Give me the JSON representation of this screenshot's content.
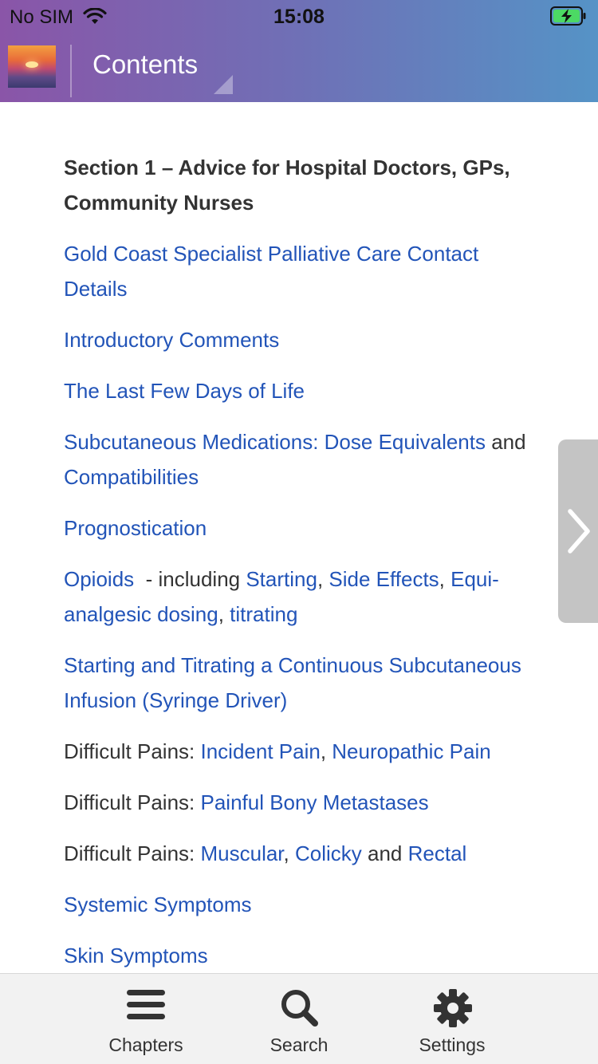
{
  "status_bar": {
    "carrier": "No SIM",
    "time": "15:08"
  },
  "header": {
    "title": "Contents"
  },
  "section_heading": "Section 1 – Advice for Hospital Doctors, GPs, Community Nurses",
  "toc": {
    "gold_coast": "Gold Coast Specialist Palliative Care Contact Details",
    "intro": "Introductory Comments",
    "last_days": "The Last Few Days of Life",
    "subcut_a": "Subcutaneous Medications: Dose Equivalents",
    "subcut_and": " and ",
    "subcut_b": "Compatibilities",
    "prognostication": "Prognostication",
    "opioids": "Opioids",
    "opioids_text": "  - including ",
    "opioids_starting": "Starting",
    "sep_comma": ", ",
    "opioids_side": "Side Effects",
    "opioids_equi": "Equi-analgesic dosing",
    "opioids_titrating": "titrating",
    "csci": "Starting and Titrating a Continuous Subcutaneous Infusion (Syringe Driver)",
    "difficult_prefix": "Difficult Pains: ",
    "incident": "Incident Pain",
    "neuropathic": "Neuropathic Pain",
    "bony": "Painful Bony Metastases",
    "muscular": "Muscular",
    "colicky": "Colicky",
    "and": " and ",
    "rectal": "Rectal",
    "systemic": "Systemic Symptoms",
    "skin": "Skin Symptoms"
  },
  "tabs": [
    {
      "label": "Chapters",
      "icon": "menu-icon"
    },
    {
      "label": "Search",
      "icon": "search-icon"
    },
    {
      "label": "Settings",
      "icon": "gear-icon"
    }
  ],
  "colors": {
    "link": "#2254b8",
    "header_start": "#8a55a8",
    "header_end": "#5593c6"
  }
}
